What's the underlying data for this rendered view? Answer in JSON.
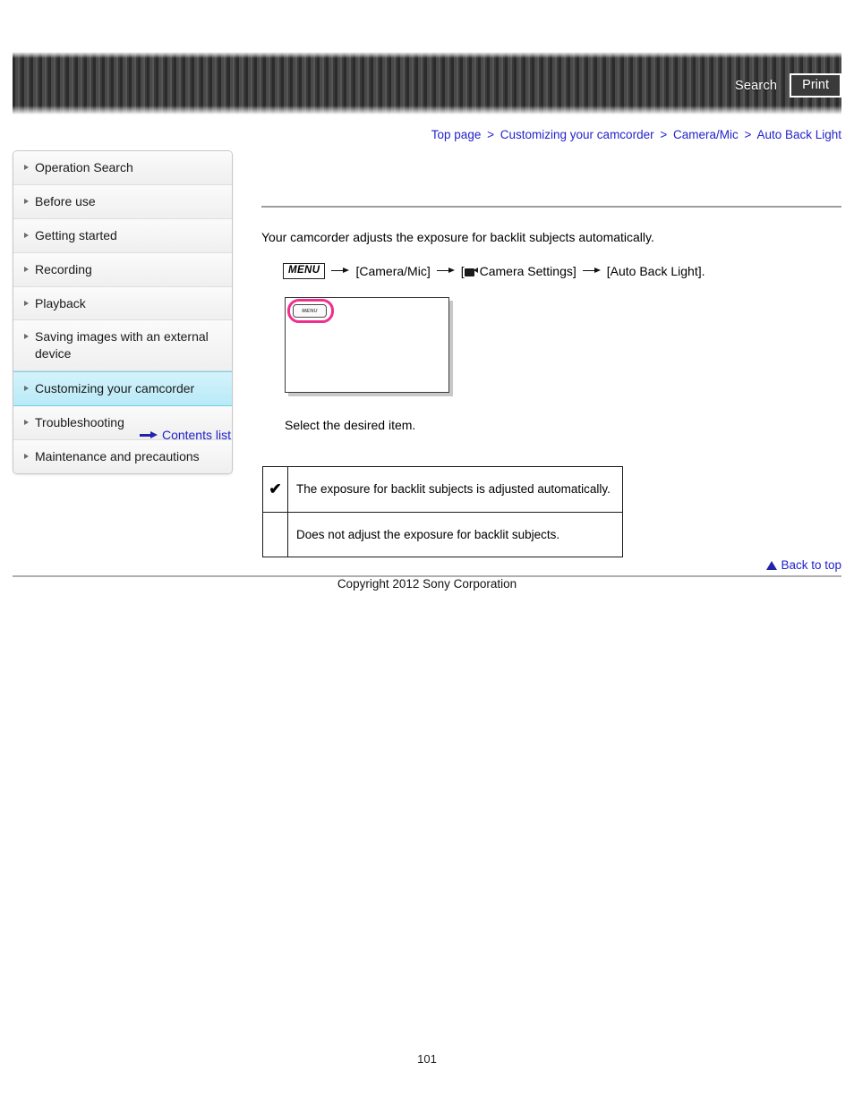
{
  "header": {
    "search_label": "Search",
    "print_label": "Print"
  },
  "breadcrumb": {
    "separator": ">",
    "items": [
      {
        "label": "Top page"
      },
      {
        "label": "Customizing your camcorder"
      },
      {
        "label": "Camera/Mic"
      },
      {
        "label": "Auto Back Light"
      }
    ]
  },
  "sidebar": {
    "items": [
      {
        "label": "Operation Search",
        "active": false
      },
      {
        "label": "Before use",
        "active": false
      },
      {
        "label": "Getting started",
        "active": false
      },
      {
        "label": "Recording",
        "active": false
      },
      {
        "label": "Playback",
        "active": false
      },
      {
        "label": "Saving images with an external device",
        "active": false
      },
      {
        "label": "Customizing your camcorder",
        "active": true
      },
      {
        "label": "Troubleshooting",
        "active": false
      },
      {
        "label": "Maintenance and precautions",
        "active": false
      }
    ],
    "contents_link": "Contents list"
  },
  "main": {
    "lead_text": "Your camcorder adjusts the exposure for backlit subjects automatically.",
    "menu_path": {
      "menu_chip": "MENU",
      "step1": "[Camera/Mic]",
      "step2_open": "[",
      "step2_label": "Camera Settings]",
      "step3": "[Auto Back Light]."
    },
    "illustration": {
      "screen_menu_label": "MENU"
    },
    "select_text": "Select the desired item.",
    "options": [
      {
        "mark": "✔",
        "description": "The exposure for backlit subjects is adjusted automatically."
      },
      {
        "mark": "",
        "description": "Does not adjust the exposure for backlit subjects."
      }
    ]
  },
  "footer": {
    "back_to_top": "Back to top",
    "copyright": "Copyright 2012 Sony Corporation",
    "page_number": "101"
  },
  "colors": {
    "link": "#2222cc",
    "highlight_pink": "#ee2f8e",
    "active_nav": "#b9eaf7"
  }
}
